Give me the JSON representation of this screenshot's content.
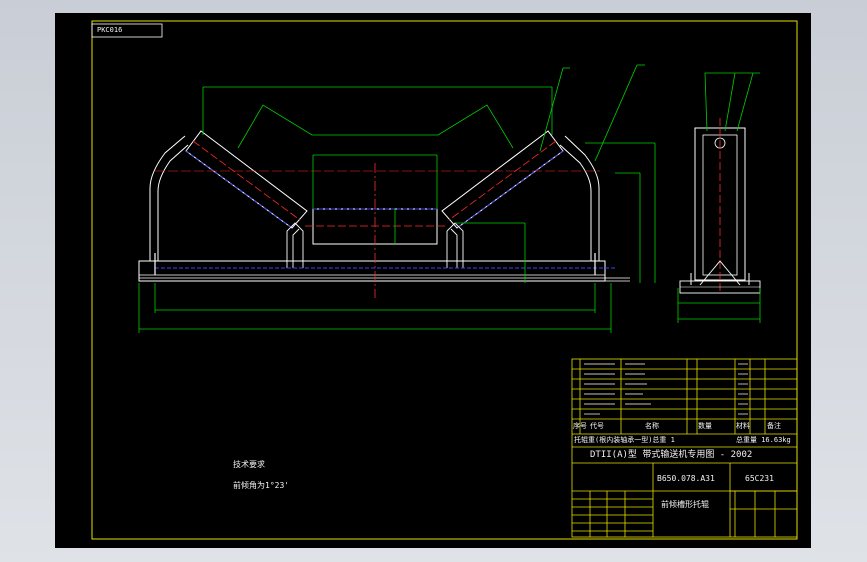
{
  "drawing": {
    "code_box": "PKC016",
    "tech_req_title": "技术要求",
    "tech_req_line": "前倾角为1°23'",
    "title_block": {
      "standard": "DTII(A)型  带式输送机专用图 - 2002",
      "drawing_no": "B650.078.A31",
      "code": "65C231",
      "part_name": "前倾槽形托辊",
      "column_headers": [
        "序号",
        "代号",
        "名称",
        "数量",
        "材料",
        "备注"
      ],
      "note_row": "托辊重(根内装轴承一型)总重 1",
      "weight_text": "总重量 16.63kg"
    },
    "colors": {
      "sheet_bg": "#000000",
      "frame": "#e8e000",
      "outline": "#ffffff",
      "dimension": "#00d000",
      "centerline": "#ff2a2a",
      "hidden": "#3a40ff",
      "leader": "#00d000"
    }
  }
}
